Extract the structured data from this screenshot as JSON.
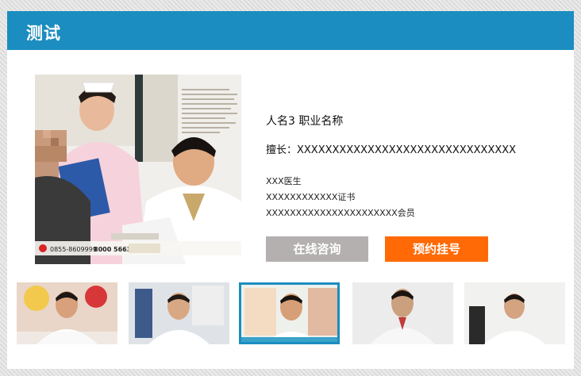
{
  "header": {
    "title": "测试"
  },
  "doctor": {
    "name_title": "人名3 职业名称",
    "specialty": "擅长：XXXXXXXXXXXXXXXXXXXXXXXXXXXXXXX",
    "credentials": [
      "XXX医生",
      "XXXXXXXXXXXX证书",
      "XXXXXXXXXXXXXXXXXXXXXX会员"
    ]
  },
  "actions": {
    "consult_label": "在线咨询",
    "appointment_label": "预约挂号"
  },
  "photo_overlay": {
    "phone_1": "0855-8609999",
    "phone_2": "8000 56638"
  },
  "thumbnails": [
    {
      "name": "doctor-1",
      "selected": false
    },
    {
      "name": "doctor-2",
      "selected": false
    },
    {
      "name": "doctor-3",
      "selected": true
    },
    {
      "name": "doctor-4",
      "selected": false
    },
    {
      "name": "doctor-5",
      "selected": false
    }
  ],
  "colors": {
    "header": "#1b8dc0",
    "consult_button": "#b4b0b0",
    "appointment_button": "#ff6a06",
    "selected_border": "#1b8dc0"
  }
}
